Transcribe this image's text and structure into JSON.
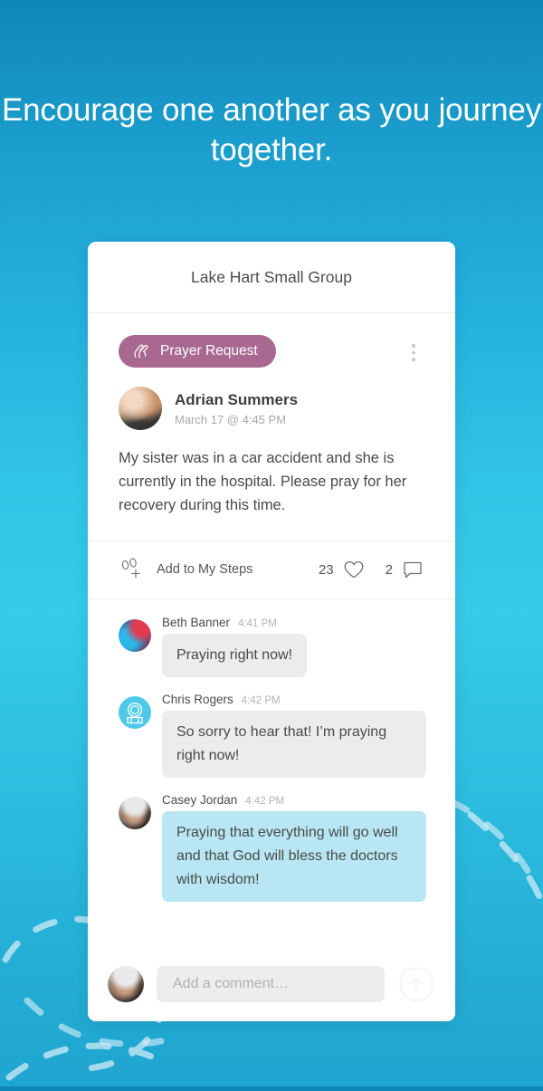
{
  "headline": "Encourage one another as you journey together.",
  "theme": {
    "bg_top": "#0e87b8",
    "bg_mid": "#35cbe9",
    "bg_bottom": "#1fa5cf",
    "badge_color": "#a96890",
    "own_bubble": "#b8e6f2",
    "other_bubble": "#ececec"
  },
  "card": {
    "header_title": "Lake Hart Small Group",
    "post": {
      "badge_label": "Prayer Request",
      "badge_icon": "praying-hands-icon",
      "menu_icon": "kebab-menu-icon",
      "author_name": "Adrian Summers",
      "timestamp": "March 17 @ 4:45 PM",
      "body": "My sister was in a car accident and she is currently in the hospital. Please pray for her recovery during this time."
    },
    "actions": {
      "steps_label": "Add to My Steps",
      "steps_icon": "footprints-add-icon",
      "like_count": "23",
      "like_icon": "heart-icon",
      "comment_count": "2",
      "comment_icon": "comment-bubble-icon"
    },
    "comments": [
      {
        "name": "Beth Banner",
        "time": "4:41 PM",
        "text": "Praying right now!",
        "own": false,
        "avatar": "beth-avatar"
      },
      {
        "name": "Chris Rogers",
        "time": "4:42 PM",
        "text": "So sorry to hear that! I’m praying right now!",
        "own": false,
        "avatar": "chris-avatar"
      },
      {
        "name": "Casey Jordan",
        "time": "4:42 PM",
        "text": "Praying that everything will go well and that God will bless the doctors with wisdom!",
        "own": true,
        "avatar": "casey-avatar"
      }
    ],
    "composer": {
      "placeholder": "Add a comment…",
      "value": "",
      "send_icon": "arrow-up-circle-icon",
      "avatar": "casey-avatar"
    }
  }
}
